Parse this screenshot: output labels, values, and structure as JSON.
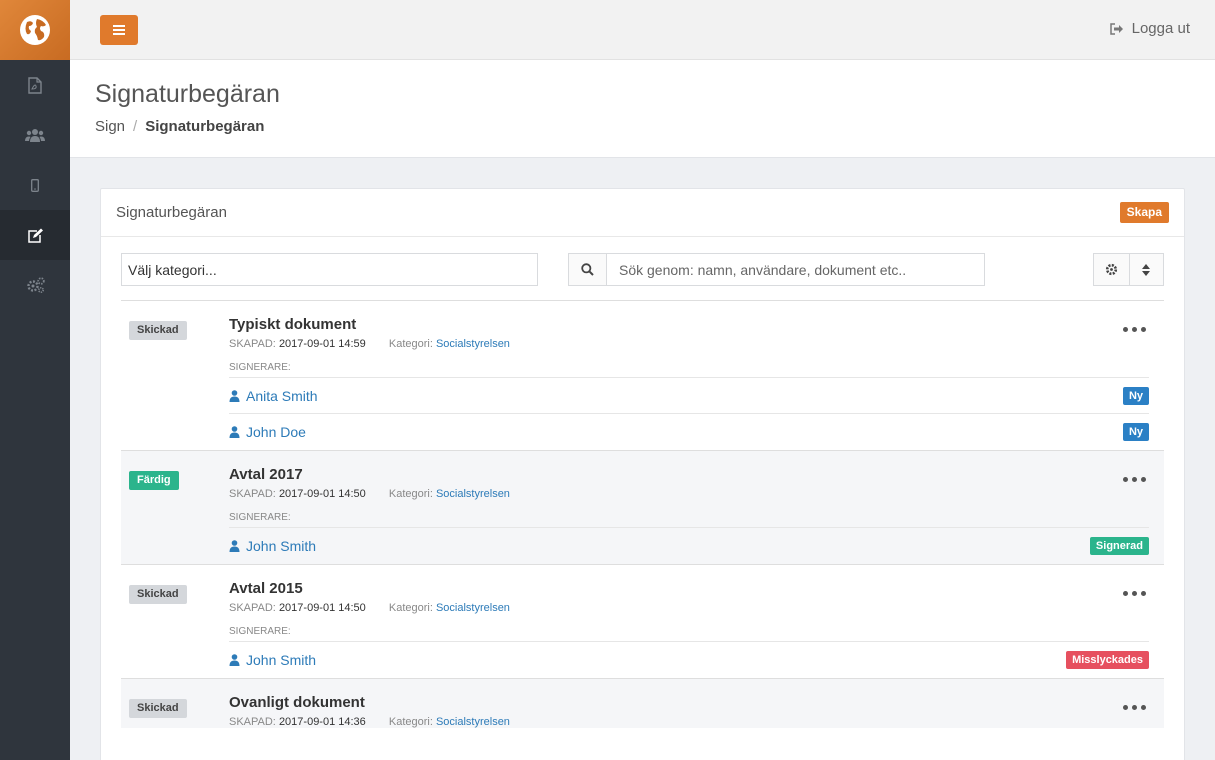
{
  "topbar": {
    "logout_label": "Logga ut"
  },
  "header": {
    "title": "Signaturbegäran",
    "breadcrumb": [
      {
        "label": "Sign"
      },
      {
        "label": "Signaturbegäran"
      }
    ]
  },
  "panel": {
    "title": "Signaturbegäran",
    "create_label": "Skapa",
    "category_select": "Välj kategori...",
    "search_placeholder": "Sök genom: namn, användare, dokument etc.."
  },
  "labels": {
    "created": "SKAPAD:",
    "category": "Kategori:",
    "signers": "SIGNERARE:"
  },
  "documents": [
    {
      "status": "Skickad",
      "title": "Typiskt dokument",
      "created": "2017-09-01 14:59",
      "category": "Socialstyrelsen",
      "signers": [
        {
          "name": "Anita Smith",
          "state": "Ny"
        },
        {
          "name": "John Doe",
          "state": "Ny"
        }
      ]
    },
    {
      "status": "Färdig",
      "title": "Avtal 2017",
      "created": "2017-09-01 14:50",
      "category": "Socialstyrelsen",
      "signers": [
        {
          "name": "John Smith",
          "state": "Signerad"
        }
      ]
    },
    {
      "status": "Skickad",
      "title": "Avtal 2015",
      "created": "2017-09-01 14:50",
      "category": "Socialstyrelsen",
      "signers": [
        {
          "name": "John Smith",
          "state": "Misslyckades"
        }
      ]
    },
    {
      "status": "Skickad",
      "title": "Ovanligt dokument",
      "created": "2017-09-01 14:36",
      "category": "Socialstyrelsen",
      "signers": []
    }
  ],
  "colors": {
    "accent": "#e07a2c",
    "sidebar": "#2f353d",
    "link": "#2d7bb8",
    "success": "#2bb48c",
    "danger": "#e6505f",
    "info": "#2b80c5"
  }
}
